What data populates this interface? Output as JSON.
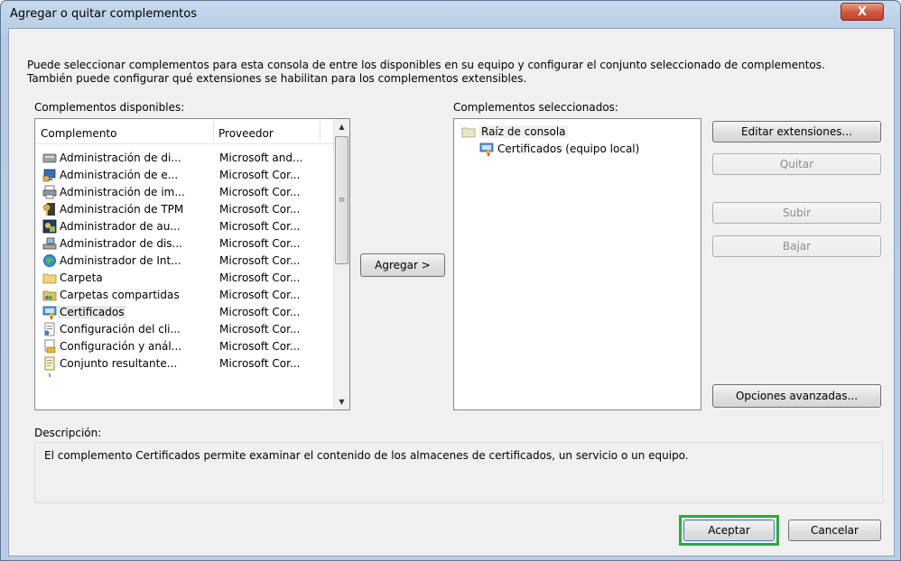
{
  "window": {
    "title": "Agregar o quitar complementos",
    "close_glyph": "X"
  },
  "intro_text": "Puede seleccionar complementos para esta consola de entre los disponibles en su equipo y configurar el conjunto seleccionado de complementos. También puede configurar qué extensiones se habilitan para los complementos extensibles.",
  "available": {
    "label": "Complementos disponibles:",
    "columns": {
      "name": "Complemento",
      "provider": "Proveedor"
    },
    "rows": [
      {
        "name": "Administración de di...",
        "provider": "Microsoft and...",
        "icon": "disk-management-icon"
      },
      {
        "name": "Administración de e...",
        "provider": "Microsoft Cor...",
        "icon": "computer-management-icon"
      },
      {
        "name": "Administración de im...",
        "provider": "Microsoft Cor...",
        "icon": "print-management-icon"
      },
      {
        "name": "Administración de TPM",
        "provider": "Microsoft Cor...",
        "icon": "tpm-key-icon"
      },
      {
        "name": "Administrador de au...",
        "provider": "Microsoft Cor...",
        "icon": "authorization-manager-icon"
      },
      {
        "name": "Administrador de dis...",
        "provider": "Microsoft Cor...",
        "icon": "device-manager-icon"
      },
      {
        "name": "Administrador de Int...",
        "provider": "Microsoft Cor...",
        "icon": "ip-security-icon"
      },
      {
        "name": "Carpeta",
        "provider": "Microsoft Cor...",
        "icon": "folder-icon"
      },
      {
        "name": "Carpetas compartidas",
        "provider": "Microsoft Cor...",
        "icon": "shared-folders-icon"
      },
      {
        "name": "Certificados",
        "provider": "Microsoft Cor...",
        "icon": "certificates-icon",
        "selected": true
      },
      {
        "name": "Configuración del cli...",
        "provider": "Microsoft Cor...",
        "icon": "client-config-icon"
      },
      {
        "name": "Configuración y anál...",
        "provider": "Microsoft Cor...",
        "icon": "security-analysis-icon"
      },
      {
        "name": "Conjunto resultante...",
        "provider": "Microsoft Cor...",
        "icon": "resultant-set-icon"
      }
    ]
  },
  "add_button": "Agregar >",
  "selected": {
    "label": "Complementos seleccionados:",
    "root": "Raíz de consola",
    "child": "Certificados (equipo local)"
  },
  "side_buttons": {
    "edit_extensions": "Editar extensiones...",
    "remove": "Quitar",
    "move_up": "Subir",
    "move_down": "Bajar",
    "advanced": "Opciones avanzadas..."
  },
  "description": {
    "label": "Descripción:",
    "text": "El complemento Certificados permite examinar el contenido de los almacenes de certificados, un servicio o un equipo."
  },
  "footer": {
    "ok": "Aceptar",
    "cancel": "Cancelar"
  },
  "colors": {
    "accept_highlight": "#2daa3f",
    "close_button": "#cf5a3f"
  }
}
